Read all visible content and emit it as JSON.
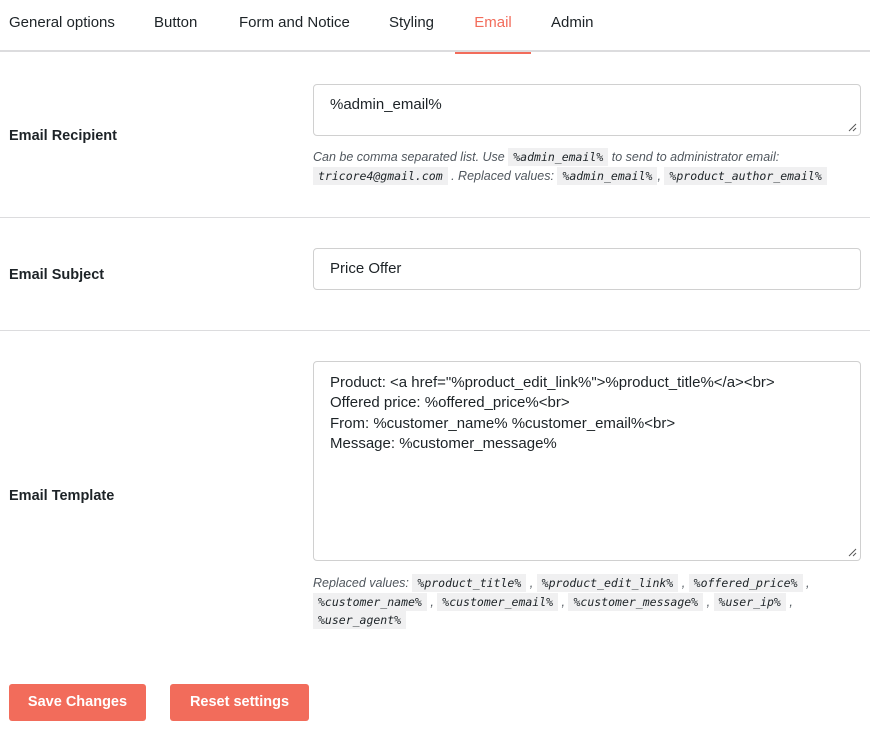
{
  "tabs": [
    {
      "label": "General options"
    },
    {
      "label": "Button"
    },
    {
      "label": "Form and Notice"
    },
    {
      "label": "Styling"
    },
    {
      "label": "Email"
    },
    {
      "label": "Admin"
    }
  ],
  "recipient": {
    "label": "Email Recipient",
    "value": "%admin_email%",
    "help_prefix": "Can be comma separated list. Use",
    "help_code1": "%admin_email%",
    "help_mid": "to send to administrator email:",
    "help_code2": "tricore4@gmail.com",
    "help_mid2": ". Replaced values:",
    "help_code3": "%admin_email%",
    "help_sep": ",",
    "help_code4": "%product_author_email%"
  },
  "subject": {
    "label": "Email Subject",
    "value": "Price Offer"
  },
  "template": {
    "label": "Email Template",
    "lines": [
      "Product: <a href=\"%product_edit_link%\">%product_title%</a><br>",
      "Offered price: %offered_price%<br>",
      "From: %customer_name% %customer_email%<br>",
      "Message: %customer_message%"
    ],
    "help_prefix": "Replaced values:",
    "codes": [
      "%product_title%",
      "%product_edit_link%",
      "%offered_price%",
      "%customer_name%",
      "%customer_email%",
      "%customer_message%",
      "%user_ip%",
      "%user_agent%"
    ]
  },
  "buttons": {
    "save": "Save Changes",
    "reset": "Reset settings"
  },
  "colors": {
    "accent": "#f26c5b"
  }
}
